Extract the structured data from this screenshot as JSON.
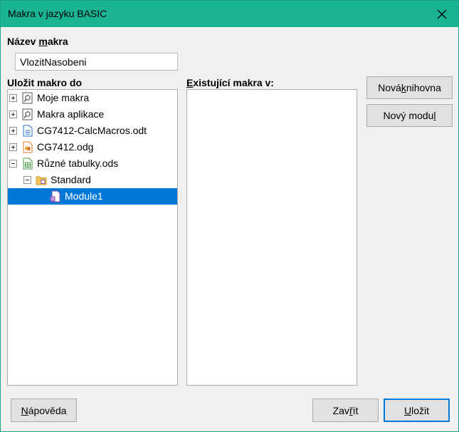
{
  "window": {
    "title": "Makra v jazyku BASIC"
  },
  "macro_name": {
    "label_prefix": "Název ",
    "label_accel": "m",
    "label_suffix": "akra",
    "value": "VlozitNasobeni"
  },
  "save_in": {
    "label": "Uložit makro do",
    "tree": [
      {
        "label": "Moje makra",
        "icon": "macro-library-icon",
        "expander": "plus"
      },
      {
        "label": "Makra aplikace",
        "icon": "macro-library-icon",
        "expander": "plus"
      },
      {
        "label": "CG7412-CalcMacros.odt",
        "icon": "writer-document-icon",
        "expander": "plus"
      },
      {
        "label": "CG7412.odg",
        "icon": "draw-document-icon",
        "expander": "plus"
      },
      {
        "label": "Různé tabulky.ods",
        "icon": "calc-spreadsheet-icon",
        "expander": "minus"
      },
      {
        "label": "Standard",
        "icon": "library-folder-icon",
        "expander": "minus"
      },
      {
        "label": "Module1",
        "icon": "basic-module-icon",
        "selected": true
      }
    ]
  },
  "existing": {
    "label_accel": "E",
    "label_rest": "xistující makra v:"
  },
  "buttons": {
    "new_library_prefix": "Nová ",
    "new_library_accel": "k",
    "new_library_suffix": "nihovna",
    "new_module_prefix": "Nový modu",
    "new_module_accel": "l",
    "new_module_suffix": "",
    "help_accel": "N",
    "help_rest": "ápověda",
    "close_prefix": "Zav",
    "close_accel": "ř",
    "close_suffix": "ít",
    "save_prefix": "",
    "save_accel": "U",
    "save_suffix": "ložit"
  },
  "colors": {
    "titlebar": "#1ab394",
    "selection": "#0078d7"
  }
}
